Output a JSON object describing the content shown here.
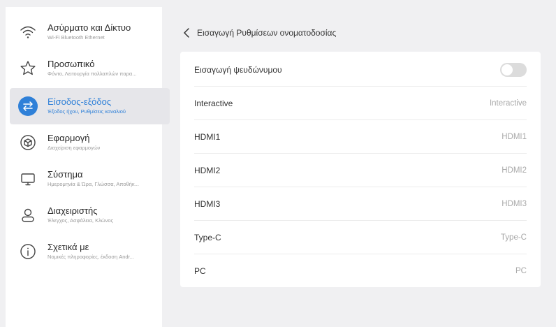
{
  "sidebar": {
    "items": [
      {
        "title": "Ασύρματο και Δίκτυο",
        "subtitle": "Wi-Fi Bluetooth Ethernet",
        "icon": "wifi-icon"
      },
      {
        "title": "Προσωπικό",
        "subtitle": "Φόντο, Λειτουργία πολλαπλών παρα...",
        "icon": "star-icon"
      },
      {
        "title": "Είσοδος-εξόδος",
        "subtitle": "Έξοδος ήχου, Ρυθμίσεις καναλιού",
        "icon": "swap-arrows-icon",
        "active": true
      },
      {
        "title": "Εφαρμογή",
        "subtitle": "Διαχείριση εφαρμογών",
        "icon": "cube-icon"
      },
      {
        "title": "Σύστημα",
        "subtitle": "Ημερομηνία & Ώρα, Γλώσσα, Αποθήκ...",
        "icon": "monitor-icon"
      },
      {
        "title": "Διαχειριστής",
        "subtitle": "Έλεγχος, Ασφάλεια, Κλώνος",
        "icon": "user-icon"
      },
      {
        "title": "Σχετικά με",
        "subtitle": "Νομικές πληροφορίες, έκδοση Andr...",
        "icon": "info-icon"
      }
    ]
  },
  "header": {
    "title": "Εισαγωγή Ρυθμίσεων ονοματοδοσίας"
  },
  "settings": {
    "pseudonym_label": "Εισαγωγή ψευδώνυμου",
    "pseudonym_enabled": false,
    "rows": [
      {
        "label": "Interactive",
        "value": "Interactive"
      },
      {
        "label": "HDMI1",
        "value": "HDMI1"
      },
      {
        "label": "HDMI2",
        "value": "HDMI2"
      },
      {
        "label": "HDMI3",
        "value": "HDMI3"
      },
      {
        "label": "Type-C",
        "value": "Type-C"
      },
      {
        "label": "PC",
        "value": "PC"
      }
    ]
  },
  "colors": {
    "accent": "#2f80d8",
    "active_bg": "#e6e6ea",
    "background": "#f0f0f2"
  }
}
